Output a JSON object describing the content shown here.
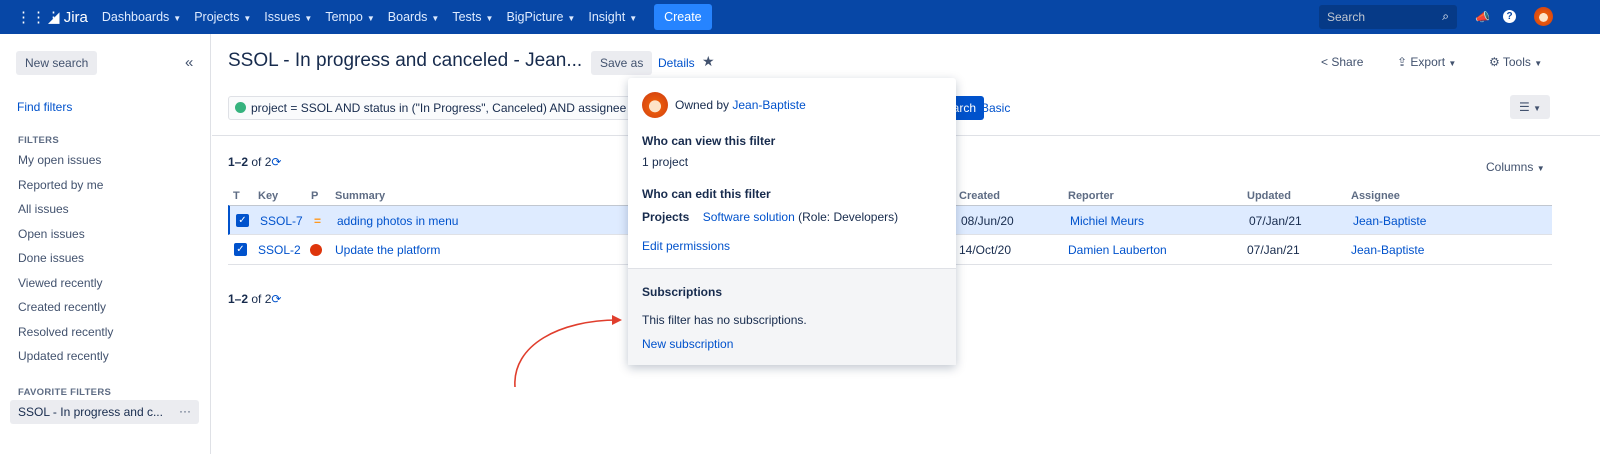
{
  "nav": {
    "logo": "Jira",
    "items": [
      "Dashboards",
      "Projects",
      "Issues",
      "Tempo",
      "Boards",
      "Tests",
      "BigPicture",
      "Insight"
    ],
    "create": "Create",
    "search_placeholder": "Search"
  },
  "sidebar": {
    "new_search": "New search",
    "collapse": "«",
    "find_filters": "Find filters",
    "filters_heading": "FILTERS",
    "filters": [
      "My open issues",
      "Reported by me",
      "All issues",
      "Open issues",
      "Done issues",
      "Viewed recently",
      "Created recently",
      "Resolved recently",
      "Updated recently"
    ],
    "favorites_heading": "FAVORITE FILTERS",
    "favorite": "SSOL - In progress and c...",
    "favorite_more": "···"
  },
  "header": {
    "title": "SSOL - In progress and canceled - Jean...",
    "save_as": "Save as",
    "details": "Details",
    "share": "Share",
    "export": "Export",
    "tools": "Tools"
  },
  "query": {
    "jql": "project = SSOL AND status in (\"In Progress\", Canceled) AND assignee = currentUser()",
    "search": "Search",
    "basic": "Basic"
  },
  "results": {
    "count_top": "1–2",
    "count_of": "of 2",
    "columns": "Columns",
    "headers": [
      "T",
      "Key",
      "P",
      "Summary",
      "Created",
      "Reporter",
      "Updated",
      "Assignee"
    ],
    "rows": [
      {
        "key": "SSOL-7",
        "summary": "adding photos in menu",
        "created": "08/Jun/20",
        "reporter": "Michiel Meurs",
        "updated": "07/Jan/21",
        "assignee": "Jean-Baptiste",
        "priority": "medium"
      },
      {
        "key": "SSOL-2",
        "summary": "Update the platform",
        "created": "14/Oct/20",
        "reporter": "Damien Lauberton",
        "updated": "07/Jan/21",
        "assignee": "Jean-Baptiste",
        "priority": "blocker"
      }
    ]
  },
  "popup": {
    "owned_by": "Owned by",
    "owner": "Jean-Baptiste",
    "view_heading": "Who can view this filter",
    "view_value": "1 project",
    "edit_heading": "Who can edit this filter",
    "edit_label": "Projects",
    "edit_project": "Software solution",
    "edit_role": "(Role: Developers)",
    "edit_permissions": "Edit permissions",
    "subs_heading": "Subscriptions",
    "subs_empty": "This filter has no subscriptions.",
    "new_subscription": "New subscription"
  },
  "colors": {
    "nav": "#0747a6",
    "accent": "#0052cc",
    "arrow": "#e03e2d"
  }
}
